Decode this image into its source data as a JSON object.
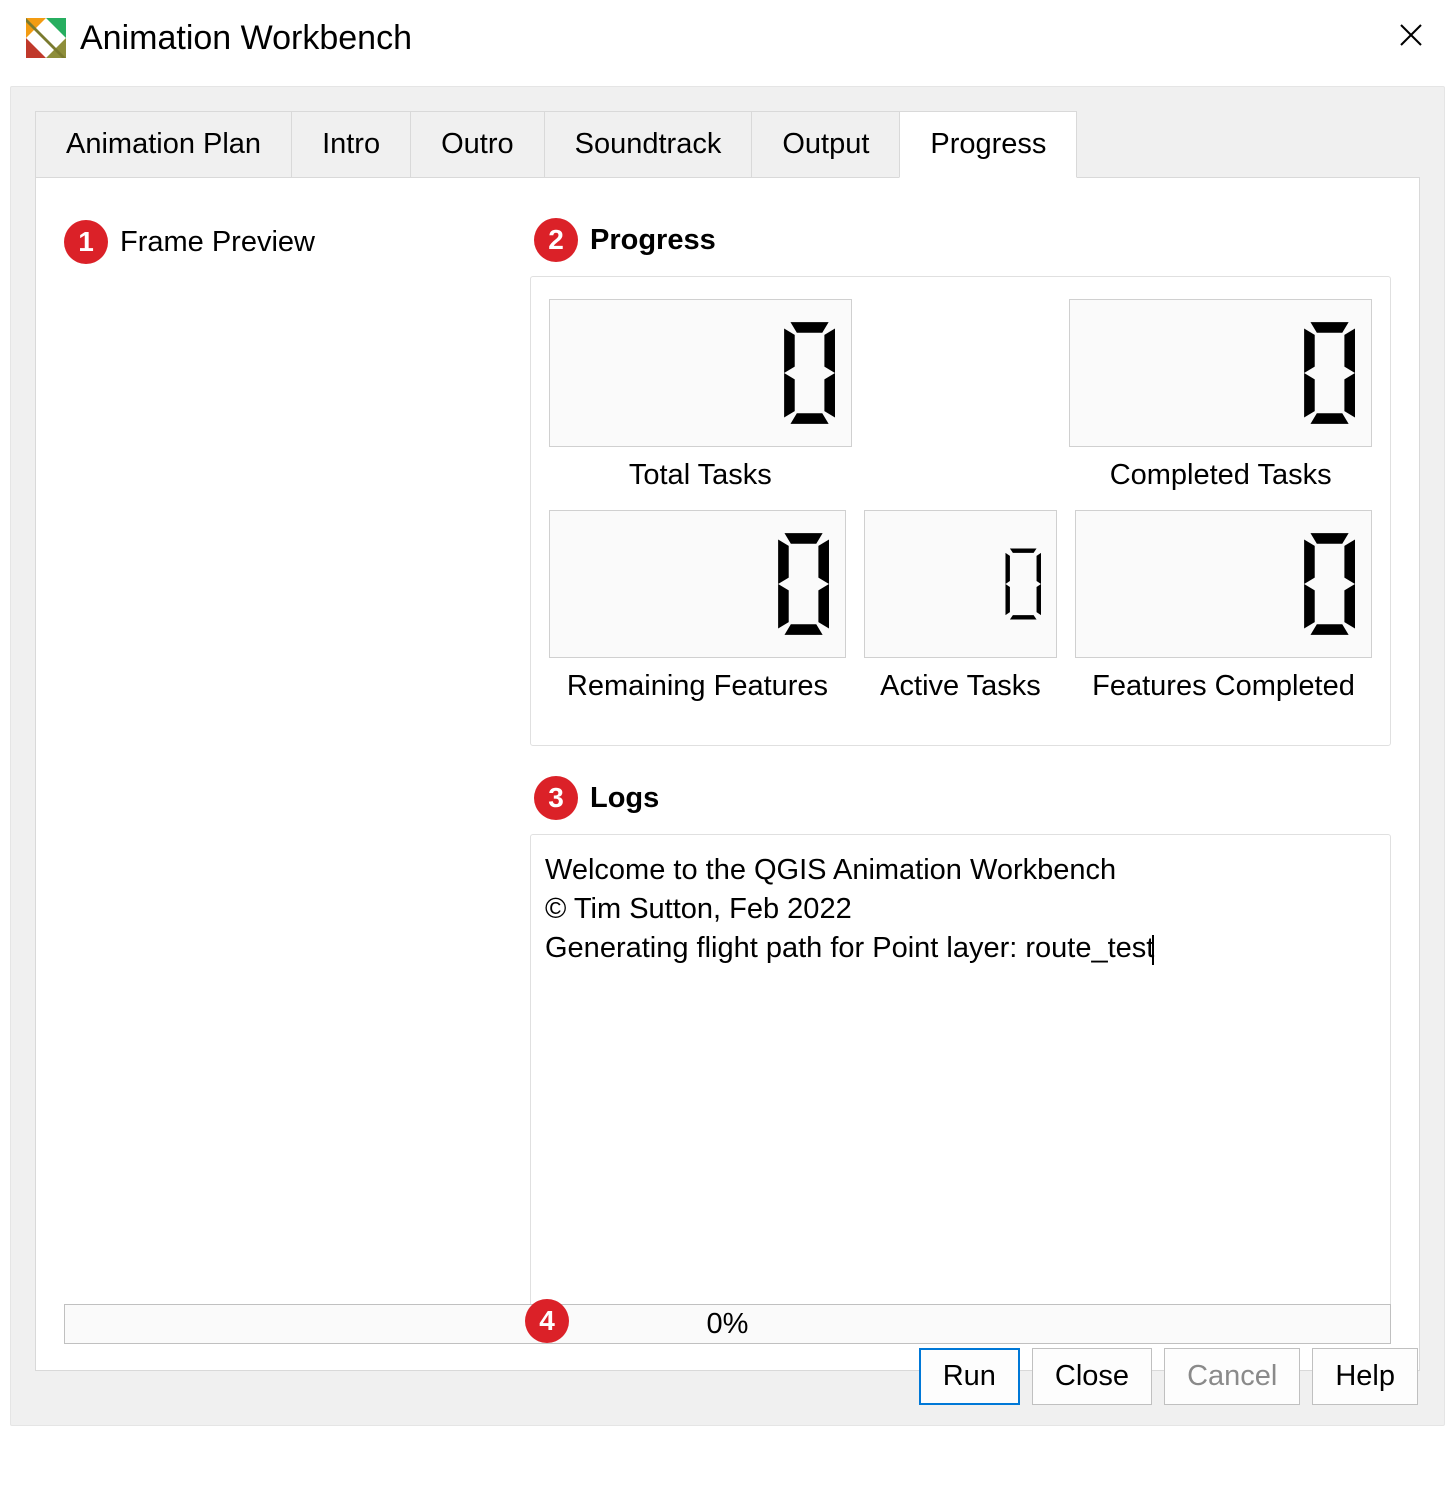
{
  "window": {
    "title": "Animation Workbench"
  },
  "tabs": {
    "items": [
      {
        "label": "Animation Plan"
      },
      {
        "label": "Intro"
      },
      {
        "label": "Outro"
      },
      {
        "label": "Soundtrack"
      },
      {
        "label": "Output"
      },
      {
        "label": "Progress"
      }
    ],
    "active_index": 5
  },
  "frame_preview": {
    "badge": "1",
    "label": "Frame Preview"
  },
  "progress_section": {
    "badge": "2",
    "title": "Progress",
    "counters": {
      "total_tasks": {
        "value": "0",
        "label": "Total Tasks"
      },
      "completed_tasks": {
        "value": "0",
        "label": "Completed Tasks"
      },
      "remaining_features": {
        "value": "0",
        "label": "Remaining Features"
      },
      "active_tasks": {
        "value": "0",
        "label": "Active Tasks"
      },
      "features_completed": {
        "value": "0",
        "label": "Features Completed"
      }
    }
  },
  "logs_section": {
    "badge": "3",
    "title": "Logs",
    "text": "Welcome to the QGIS Animation Workbench\n© Tim Sutton, Feb 2022\nGenerating flight path for Point layer: route_test"
  },
  "progress_bar": {
    "badge": "4",
    "text": "0%"
  },
  "buttons": {
    "run": "Run",
    "close": "Close",
    "cancel": "Cancel",
    "help": "Help"
  }
}
